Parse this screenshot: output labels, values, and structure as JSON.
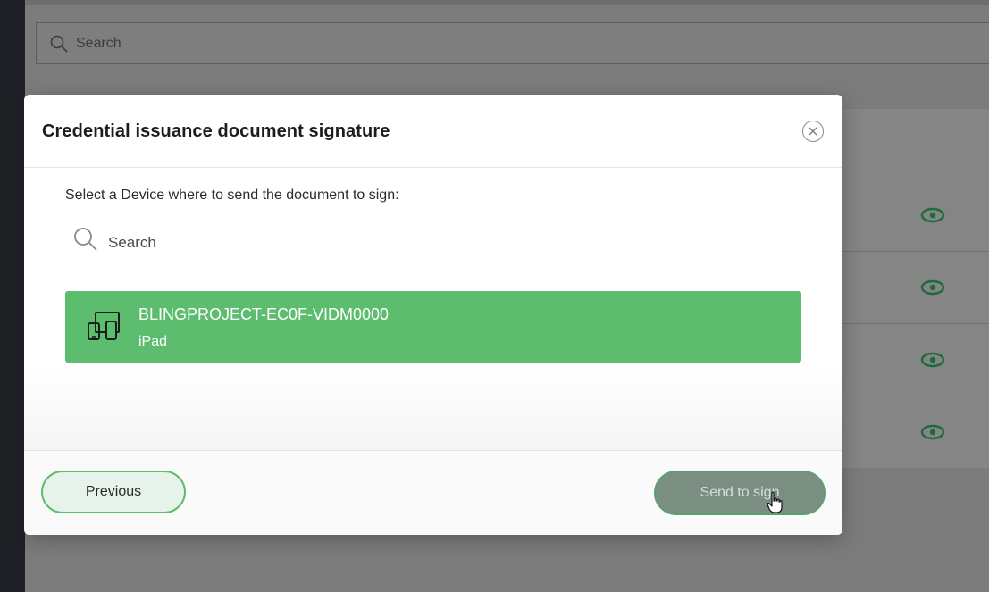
{
  "background": {
    "search_placeholder": "Search",
    "row_icons": [
      "eye-icon",
      "eye-icon",
      "eye-icon",
      "eye-icon"
    ]
  },
  "modal": {
    "title": "Credential issuance document signature",
    "instruction": "Select a Device where to send the document to sign:",
    "search_placeholder": "Search",
    "device": {
      "name": "BLINGPROJECT-EC0F-VIDM0000",
      "type": "iPad",
      "icon": "devices-icon",
      "selected": true
    },
    "previous_label": "Previous",
    "send_label": "Send to sign"
  },
  "colors": {
    "accent_green": "#5cbd6e",
    "eye_green": "#1e6b3a"
  }
}
